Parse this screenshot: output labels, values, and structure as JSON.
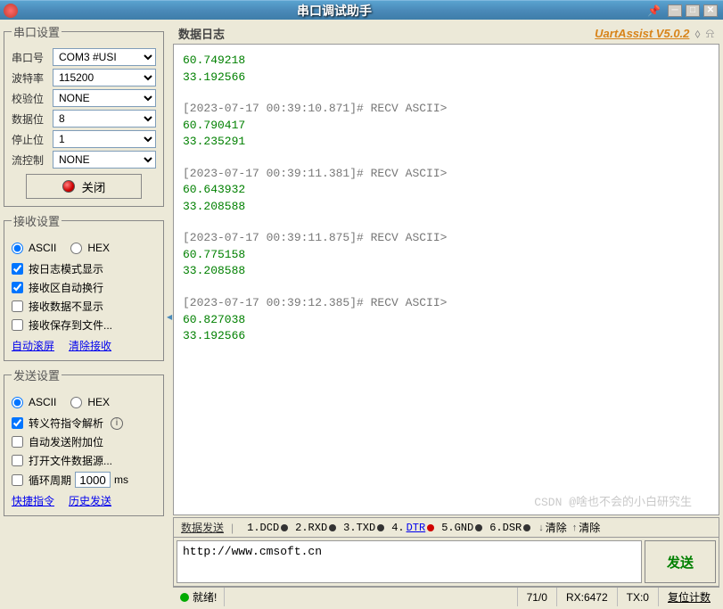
{
  "title": "串口调试助手",
  "brand": "UartAssist V5.0.2",
  "serial": {
    "legend": "串口设置",
    "port_lbl": "串口号",
    "port": "COM3 #USI",
    "baud_lbl": "波特率",
    "baud": "115200",
    "parity_lbl": "校验位",
    "parity": "NONE",
    "data_lbl": "数据位",
    "data": "8",
    "stop_lbl": "停止位",
    "stop": "1",
    "flow_lbl": "流控制",
    "flow": "NONE",
    "conn_btn": "关闭"
  },
  "recv": {
    "legend": "接收设置",
    "ascii": "ASCII",
    "hex": "HEX",
    "logmode": "按日志模式显示",
    "autowrap": "接收区自动换行",
    "hidedata": "接收数据不显示",
    "savefile": "接收保存到文件...",
    "autoscroll": "自动滚屏",
    "clear": "清除接收"
  },
  "send": {
    "legend": "发送设置",
    "ascii": "ASCII",
    "hex": "HEX",
    "escape": "转义符指令解析",
    "autoextra": "自动发送附加位",
    "openfile": "打开文件数据源...",
    "loop_lbl": "循环周期",
    "loop_val": "1000",
    "loop_unit": "ms",
    "shortcut": "快捷指令",
    "history": "历史发送"
  },
  "log": {
    "title": "数据日志",
    "entries": [
      {
        "ts": "",
        "lines": [
          "60.749218",
          "33.192566"
        ]
      },
      {
        "ts": "[2023-07-17 00:39:10.871]# RECV ASCII>",
        "lines": [
          "60.790417",
          "33.235291"
        ]
      },
      {
        "ts": "[2023-07-17 00:39:11.381]# RECV ASCII>",
        "lines": [
          "60.643932",
          "33.208588"
        ]
      },
      {
        "ts": "[2023-07-17 00:39:11.875]# RECV ASCII>",
        "lines": [
          "60.775158",
          "33.208588"
        ]
      },
      {
        "ts": "[2023-07-17 00:39:12.385]# RECV ASCII>",
        "lines": [
          "60.827038",
          "33.192566"
        ]
      }
    ]
  },
  "sendpanel": {
    "tab": "数据发送",
    "signals": [
      {
        "n": "1",
        "name": "DCD",
        "on": false
      },
      {
        "n": "2",
        "name": "RXD",
        "on": false
      },
      {
        "n": "3",
        "name": "TXD",
        "on": false
      },
      {
        "n": "4",
        "name": "DTR",
        "on": true
      },
      {
        "n": "5",
        "name": "GND",
        "on": false
      },
      {
        "n": "6",
        "name": "DSR",
        "on": false
      }
    ],
    "clear1": "清除",
    "clear2": "清除",
    "text": "http://www.cmsoft.cn",
    "sendbtn": "发送"
  },
  "status": {
    "ready": "就绪!",
    "col2": "71/0",
    "rx": "RX:6472",
    "tx": "TX:0",
    "reset": "复位计数"
  },
  "watermark": "CSDN @啥也不会的小白研究生"
}
